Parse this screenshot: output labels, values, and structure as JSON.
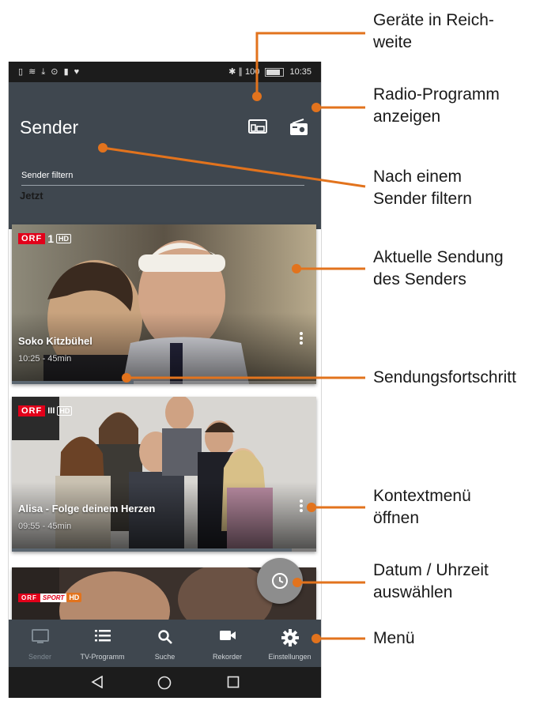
{
  "status_bar": {
    "icons_left": "▯ ≋ ⤓ ⊙ ▮ ♥",
    "icons_right": "✱ ∥ 100",
    "time": "10:35"
  },
  "app_bar": {
    "title": "Sender",
    "devices_icon": "cast-devices-icon",
    "radio_icon": "radio-icon"
  },
  "filter": {
    "placeholder": "Sender filtern"
  },
  "section": {
    "label": "Jetzt"
  },
  "programs": [
    {
      "channel_logo": "ORF 1 HD",
      "title": "Soko Kitzbühel",
      "time": "10:25 - 45min",
      "progress": 0.4
    },
    {
      "channel_logo": "ORF III HD",
      "title": "Alisa - Folge deinem Herzen",
      "time": "09:55 - 45min",
      "progress": 0.92
    },
    {
      "channel_logo": "ORF SPORT + HD",
      "title": "",
      "time": "",
      "progress": 0
    }
  ],
  "fab": {
    "icon": "clock-icon"
  },
  "bottom_nav": [
    {
      "label": "Sender",
      "icon": "tv-icon",
      "active": true
    },
    {
      "label": "TV-Programm",
      "icon": "list-icon",
      "active": false
    },
    {
      "label": "Suche",
      "icon": "search-icon",
      "active": false
    },
    {
      "label": "Rekorder",
      "icon": "video-camera-icon",
      "active": false
    },
    {
      "label": "Einstellungen",
      "icon": "gear-icon",
      "active": false
    }
  ],
  "android_nav": {
    "back_icon": "back-triangle-icon",
    "home_icon": "home-circle-icon",
    "recents_icon": "recents-square-icon"
  },
  "callouts": [
    {
      "label": "Geräte in Reich-\nweite"
    },
    {
      "label": "Radio-Programm\nanzeigen"
    },
    {
      "label": "Nach einem\nSender filtern"
    },
    {
      "label": "Aktuelle Sendung\ndes Senders"
    },
    {
      "label": "Sendungsfortschritt"
    },
    {
      "label": "Kontextmenü\nöffnen"
    },
    {
      "label": "Datum / Uhrzeit\nauswählen"
    },
    {
      "label": "Menü"
    }
  ],
  "colors": {
    "app_bar": "#3f474f",
    "accent_orange": "#e2731d",
    "orf_red": "#e2001a",
    "fab": "#8d8d8d"
  }
}
